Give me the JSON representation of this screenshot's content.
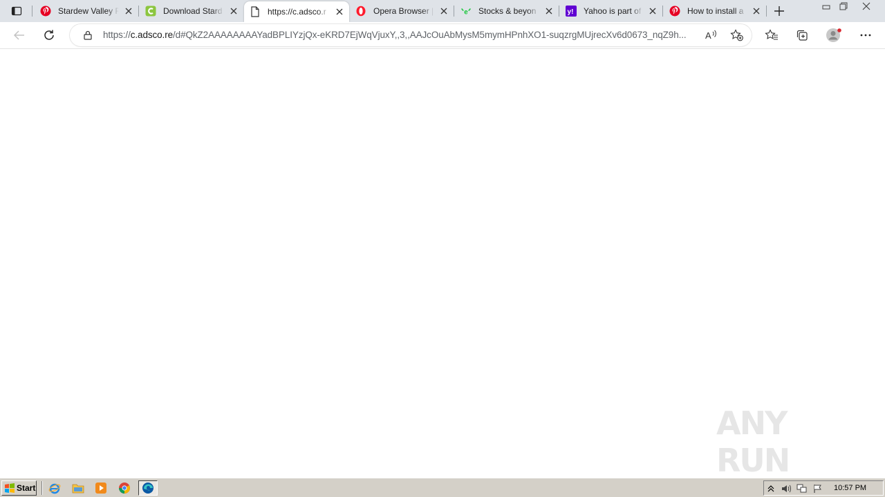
{
  "browser": {
    "tabs": [
      {
        "title": "Stardew Valley F",
        "favicon": "pinterest-icon",
        "active": false
      },
      {
        "title": "Download Stard",
        "favicon": "c-letter-icon",
        "active": false
      },
      {
        "title": "https://c.adsco.r",
        "favicon": "page-icon",
        "active": true
      },
      {
        "title": "Opera Browser |",
        "favicon": "opera-icon",
        "active": false
      },
      {
        "title": "Stocks & beyon",
        "favicon": "etoro-icon",
        "active": false
      },
      {
        "title": "Yahoo is part of",
        "favicon": "yahoo-icon",
        "active": false
      },
      {
        "title": "How to install a",
        "favicon": "pinterest-icon",
        "active": false
      }
    ],
    "address": {
      "scheme": "https://",
      "host": "c.adsco.re",
      "path": "/d#QkZ2AAAAAAAAYadBPLIYzjQx-eKRD7EjWqVjuxY,,3,,AAJcOuAbMysM5mymHPnhXO1-suqzrgMUjrecXv6d0673_nqZ9h..."
    },
    "colors": {
      "pinterest": "#e60023",
      "c_green": "#8cc63f",
      "opera": "#ff1b2d",
      "etoro": "#13c636",
      "yahoo": "#6001d2",
      "profile_dot": "#d9262e"
    }
  },
  "page": {
    "watermark": "ANY RUN"
  },
  "taskbar": {
    "start_label": "Start",
    "quick_launch": [
      "ie-icon",
      "explorer-folder-icon",
      "media-player-icon",
      "chrome-icon",
      "edge-icon"
    ],
    "clock": "10:57 PM"
  }
}
